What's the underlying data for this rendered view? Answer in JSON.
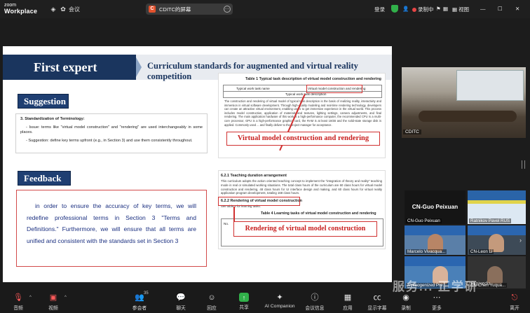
{
  "topbar": {
    "brand_top": "zoom",
    "brand_bottom": "Workplace",
    "meeting_label": "会议",
    "share_title": "CDITC的屏幕",
    "share_icon_letter": "C",
    "login": "登录",
    "recording": "录制中",
    "view": "视图"
  },
  "slide": {
    "header_left": "First expert",
    "header_right": "Curriculum standards for augmented and virtual reality competition",
    "suggestion_label": "Suggestion",
    "feedback_label": "Feedback",
    "term_heading": "3. Standardization of Terminology:",
    "term_issue": "- Issue: terms like \"virtual model construction\" and \"rendering\" are used interchangeably in some places.",
    "term_suggestion": "- Suggestion: define key terms upfront (e.g., in Section 3) and use them consistently throughout.",
    "feedback_text": "in order to ensure the accuracy of key terms, we will redefine professional terms in Section 3 \"Terms and Definitions.\" Furthermore, we will ensure that all terms are unified and consistent with the standards set in Section 3",
    "doc1_caption": "Table 1   Typical task description of virtual model construction and rendering",
    "doc1_col1": "Typical work task name",
    "doc1_col2": "Virtual model construction and rendering",
    "doc1_row2": "Typical work task description",
    "doc1_body": "The construction and rendering of virtual model of typical task description is the basis of realizing reality, interactivity and immersion in virtual software development. Through high-quality modeling and real-time rendering technology, developers can create an attractive virtual environment, enabling users to get immersive experience in the virtual world. This process includes model construction, application of materials and textures, lighting settings, camera adjustments, and final rendering. The main application hardware of this work is a high-performance computer, the recommended CPU is a multi-core processor, GPU is a high-performance graphics card, the RAM is at least 16GB and the solid-state storage disk is applied. Commonly used ... and finally deliver to the project manager for acceptance.",
    "callout1": "Virtual model construction and rendering",
    "doc2_h1": "6.2.1   Teaching duration arrangement",
    "doc2_b1": "This curriculum adopts the action oriented teaching concept to implement the \"integration of theory and reality\" teaching mode in real or simulated working situations. The total class hours of the curriculum are 60 class hours for virtual model construction and rendering, 48 class hours for UI interface design and making, and 60 class hours for virtual reality application program development, totaling 168 class hours.",
    "doc2_h2": "6.2.2   Rendering of virtual model construction",
    "doc2_b2": "See table 4 for learning tasks.",
    "doc2_cap": "Table 4   Learning tasks of virtual model construction and rendering",
    "doc2_no": "No.",
    "callout2": "Rendering of virtual model construction"
  },
  "videos": {
    "main_label": "CDITC",
    "tiles": [
      {
        "name": "CN-Guo Peixuan",
        "big": "CN-Guo Peixuan"
      },
      {
        "name": "Ratnikov Pavel RUS"
      },
      {
        "name": "Marcelo Vivacqua..."
      },
      {
        "name": "CN-Leon Li"
      },
      {
        "name": "A nitrogenized Pre..."
      },
      {
        "name": "CN-Chen Yuqua..."
      }
    ]
  },
  "bottombar": {
    "items": [
      {
        "label": "音频",
        "icon": "mic-muted-icon"
      },
      {
        "label": "视频",
        "icon": "video-off-icon"
      },
      {
        "label": "参会者",
        "icon": "participants-icon",
        "count": "35"
      },
      {
        "label": "聊天",
        "icon": "chat-icon"
      },
      {
        "label": "回应",
        "icon": "reaction-icon"
      },
      {
        "label": "共享",
        "icon": "share-icon"
      },
      {
        "label": "AI Companion",
        "icon": "ai-companion-icon"
      },
      {
        "label": "会议信息",
        "icon": "info-icon"
      },
      {
        "label": "应用",
        "icon": "apps-icon"
      },
      {
        "label": "显示字幕",
        "icon": "captions-icon"
      },
      {
        "label": "录制",
        "icon": "record-icon"
      },
      {
        "label": "更多",
        "icon": "more-icon"
      },
      {
        "label": "离开",
        "icon": "leave-icon"
      }
    ]
  },
  "watermark": {
    "main": "服务... 正学研",
    "sub": "Chinajxedu"
  },
  "colors": {
    "slide_navy": "#1a355e",
    "callout_red": "#c81f1f",
    "share_green": "#31b04a",
    "record_red": "#e64545"
  }
}
